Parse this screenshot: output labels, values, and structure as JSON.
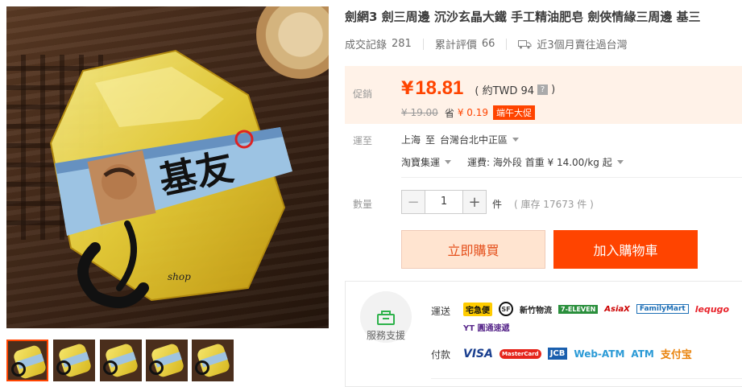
{
  "product": {
    "title": "劍網3 劍三周邊 沉沙玄晶大鐵 手工精油肥皂 劍俠情緣三周邊 基三",
    "image_text": {
      "soap_label": "基友",
      "shop_mark": "shop"
    }
  },
  "stats": {
    "sales_label": "成交記錄",
    "sales_count": "281",
    "reviews_label": "累計評價",
    "reviews_count": "66",
    "delivery_text": "近3個月賣往過台灣"
  },
  "price": {
    "label": "促銷",
    "currency": "¥",
    "amount": "18.81",
    "approx_prefix": "( 約TWD 94",
    "approx_help": "?",
    "approx_suffix": ")",
    "original": "¥ 19.00",
    "save_label": "省",
    "save_amount": "¥ 0.19",
    "promo_tag": "端午大促"
  },
  "shipping": {
    "label": "運至",
    "from": "上海",
    "to_word": "至",
    "destination": "台灣台北中正區",
    "method": "淘寶集運",
    "fee_text": "運費: 海外段 首重 ¥ 14.00/kg 起"
  },
  "quantity": {
    "label": "數量",
    "minus": "−",
    "value": "1",
    "plus": "+",
    "unit": "件",
    "stock": "( 庫存 17673 件 )"
  },
  "actions": {
    "buy_now": "立即購買",
    "add_to_cart": "加入購物車"
  },
  "service": {
    "title": "服務支援",
    "shipping_label": "運送",
    "shipping_logos": [
      "宅急便",
      "SF",
      "新竹物流",
      "7-ELEVEN",
      "AsiaX",
      "FamilyMart",
      "lequgo",
      "YT 圓通速遞"
    ],
    "payment_label": "付款",
    "payment_logos": [
      "VISA",
      "MasterCard",
      "JCB",
      "Web-ATM",
      "ATM",
      "支付宝"
    ]
  },
  "colors": {
    "accent": "#ff4400",
    "price_bg": "#fff2e8",
    "buy_bg": "#ffe4d0"
  }
}
